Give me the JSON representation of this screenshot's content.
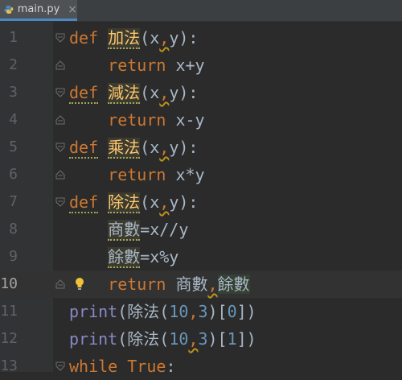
{
  "tab": {
    "filename": "main.py",
    "close": "×"
  },
  "line_numbers": [
    "1",
    "2",
    "3",
    "4",
    "5",
    "6",
    "7",
    "8",
    "9",
    "10",
    "11",
    "12",
    "13"
  ],
  "code": {
    "l1": {
      "kw": "def",
      "name": "加法",
      "rest": "(x",
      "comma": ",",
      "rest2": "y):"
    },
    "l2": {
      "kw": "return",
      "rest": " x+y"
    },
    "l3": {
      "kw": "def",
      "name": "減法",
      "rest": "(x",
      "comma": ",",
      "rest2": "y):"
    },
    "l4": {
      "kw": "return",
      "rest": " x-y"
    },
    "l5": {
      "kw": "def",
      "name": "乘法",
      "rest": "(x",
      "comma": ",",
      "rest2": "y):"
    },
    "l6": {
      "kw": "return",
      "rest": " x*y"
    },
    "l7": {
      "kw": "def",
      "name": "除法",
      "rest": "(x",
      "comma": ",",
      "rest2": "y):"
    },
    "l8": {
      "var": "商數",
      "rest": "=x//y"
    },
    "l9": {
      "var": "餘數",
      "rest": "=x%y"
    },
    "l10": {
      "kw": "return",
      "v1": "商數",
      "comma": ",",
      "v2": "餘數"
    },
    "l11": {
      "fn": "print",
      "p1": "(",
      "call": "除法",
      "p2": "(",
      "n1": "10",
      "comma": ",",
      "n2": "3",
      "p3": ")[",
      "n3": "0",
      "p4": "])"
    },
    "l12": {
      "fn": "print",
      "p1": "(",
      "call": "除法",
      "p2": "(",
      "n1": "10",
      "comma": ",",
      "n2": "3",
      "p3": ")[",
      "n3": "1",
      "p4": "])"
    },
    "l13": {
      "kw": "while",
      "val": "True",
      "rest": ":"
    }
  }
}
